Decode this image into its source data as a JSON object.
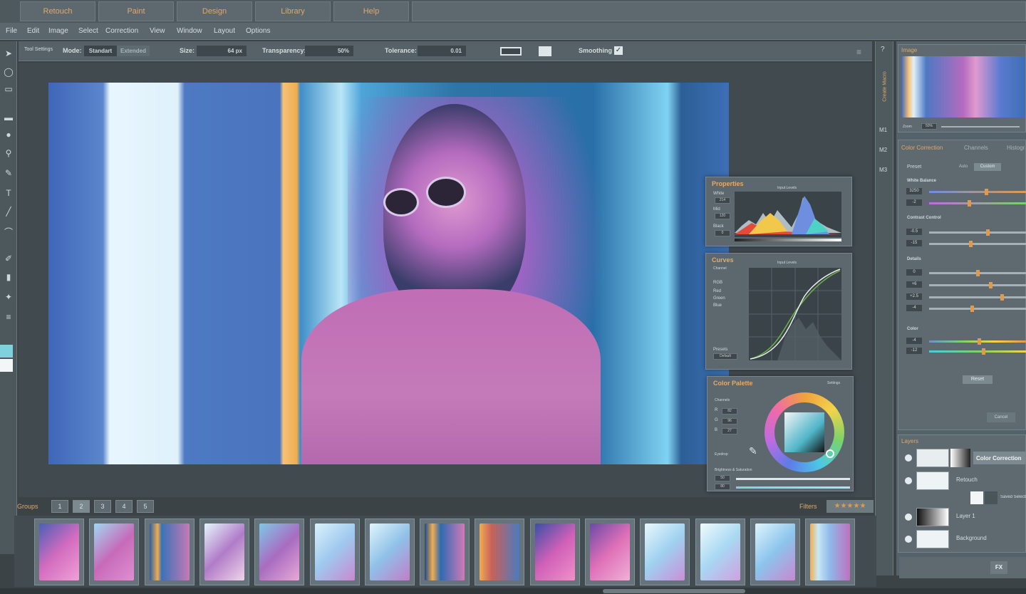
{
  "top_tabs": [
    "Retouch",
    "Paint",
    "Design",
    "Library",
    "Help"
  ],
  "menu": [
    "File",
    "Edit",
    "Image",
    "Select",
    "Correction",
    "View",
    "Window",
    "Layout",
    "Options"
  ],
  "options_bar": {
    "tool_settings": "Tool Settings",
    "mode_label": "Mode:",
    "mode_standard": "Standart",
    "mode_extended": "Extended",
    "size_label": "Size:",
    "size_value": "64 px",
    "transparency_label": "Transparency:",
    "transparency_value": "50%",
    "tolerance_label": "Tolerance:",
    "tolerance_value": "0.01",
    "smoothing_label": "Smoothing",
    "smoothing_checked": true
  },
  "properties_panel": {
    "title": "Properties",
    "histogram_title": "Input Levels",
    "rows": [
      {
        "label": "White",
        "value": "214"
      },
      {
        "label": "Mid",
        "value": "120"
      },
      {
        "label": "Black",
        "value": "0"
      }
    ]
  },
  "curves_panel": {
    "title": "Curves",
    "subtitle": "Channel",
    "graph_title": "Input Levels",
    "channels": [
      "RGB",
      "Red",
      "Green",
      "Blue"
    ],
    "preset_label": "Presets",
    "preset_value": "Default"
  },
  "color_palette_panel": {
    "title": "Color Palette",
    "settings": "Settings",
    "channels_label": "Channels",
    "channels": [
      {
        "label": "R",
        "value": "82"
      },
      {
        "label": "G",
        "value": "96"
      },
      {
        "label": "B",
        "value": "27"
      }
    ],
    "picker_label": "Eyedrop",
    "brightness_label": "Brightness & Saturation",
    "brightness_values": [
      "50",
      "80"
    ]
  },
  "right_column": {
    "help": "?",
    "vertical_label": "Create Macro",
    "macros": [
      "M1",
      "M2",
      "M3"
    ]
  },
  "image_panel": {
    "title": "Image",
    "zoom_label": "Zoom",
    "zoom_value": "50%"
  },
  "color_correction": {
    "tabs": [
      "Color Correction",
      "Channels",
      "Histogram"
    ],
    "preset_label": "Preset",
    "preset_auto": "Auto",
    "preset_custom": "Custom",
    "white_balance_label": "White Balance",
    "white_balance_values": [
      "3250",
      "-2"
    ],
    "contrast_label": "Contrast Control",
    "contrast_values": [
      "-0.5",
      "-15"
    ],
    "details_label": "Details",
    "details_values": [
      "0",
      "+6",
      "+2.5",
      "-4"
    ],
    "color_label": "Color",
    "color_values": [
      "-4",
      "-12"
    ],
    "reset_label": "Reset",
    "cancel_label": "Cancel"
  },
  "layers_panel": {
    "title": "Layers",
    "layers": [
      {
        "name": "Color Correction"
      },
      {
        "name": "Retouch"
      },
      {
        "name": "Saved Selection"
      },
      {
        "name": "Layer 1"
      },
      {
        "name": "Background"
      }
    ],
    "fx_label": "FX"
  },
  "bottom": {
    "groups_label": "Groups",
    "groups": [
      "1",
      "2",
      "3",
      "4",
      "5"
    ],
    "filters_label": "Filters",
    "filters_rating": "★★★★★"
  },
  "thumbnails_count": 15
}
